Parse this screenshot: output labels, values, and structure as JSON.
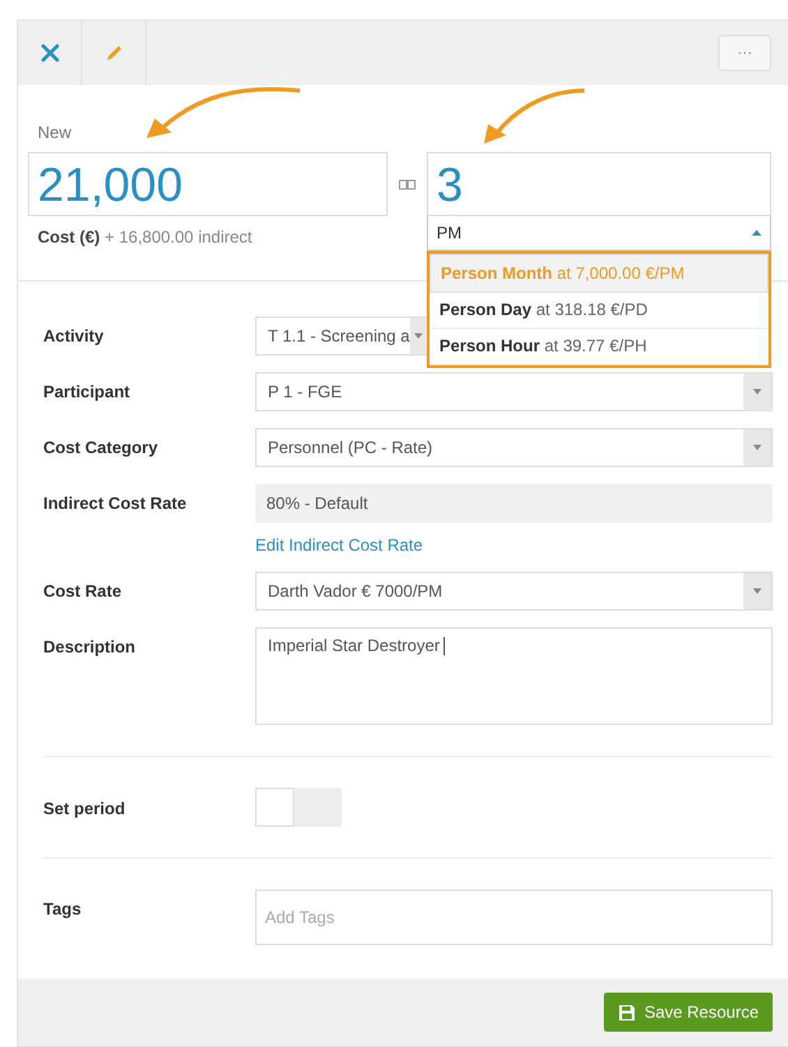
{
  "toolbar": {
    "more": "···"
  },
  "amount": {
    "label": "New",
    "cost": "21,000",
    "cost_note": "**Cost (€)** + 16,800.00 indirect",
    "quantity": "3",
    "unit": "PM",
    "unit_open": true
  },
  "unit_options": [
    {
      "label": "**Person Month** at 7,000.00 €/PM",
      "selected": true
    },
    {
      "label": "**Person Day** at 318.18 €/PD",
      "selected": false
    },
    {
      "label": "**Person Hour** at 39.77 €/PH",
      "selected": false
    }
  ],
  "fields": [
    {
      "kind": "select",
      "label": "Activity",
      "value": "T 1.1 - Screening a"
    },
    {
      "kind": "select",
      "label": "Participant",
      "value": "P 1 - FGE"
    },
    {
      "kind": "select",
      "label": "Cost Category",
      "value": "Personnel (PC - Rate)"
    },
    {
      "kind": "readonly",
      "label": "Indirect Cost Rate",
      "value": "80% - Default",
      "link": "Edit Indirect Cost Rate"
    },
    {
      "kind": "select",
      "label": "Cost Rate",
      "value": "Darth Vador € 7000/PM"
    },
    {
      "kind": "textarea",
      "label": "Description",
      "value": "Imperial Star Destroyer"
    },
    {
      "kind": "toggle",
      "label": "Set period",
      "on": false
    },
    {
      "kind": "tags",
      "label": "Tags",
      "placeholder": "Add Tags"
    }
  ],
  "footer": {
    "save": "Save Resource"
  }
}
